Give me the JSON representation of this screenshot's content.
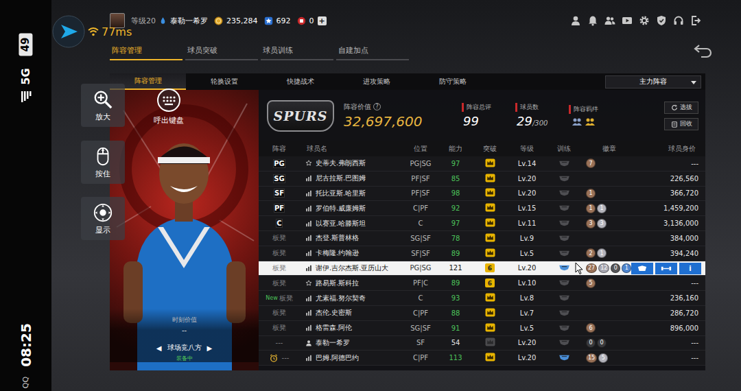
{
  "status_bar": {
    "battery": "49",
    "network": "5G",
    "time": "08:25",
    "app": "QQ"
  },
  "emulator": {
    "ping": "77ms",
    "controls": [
      {
        "label": "放大"
      },
      {
        "label": "呼出键盘"
      },
      {
        "label": "按住"
      },
      {
        "label": "显示"
      }
    ]
  },
  "profile": {
    "level": "等级20",
    "name": "泰勒一希罗",
    "coins": "235,284",
    "stars": "692",
    "tickets": "0",
    "add": "+"
  },
  "tabs": [
    {
      "label": "阵容管理",
      "selected": true
    },
    {
      "label": "球员突破",
      "selected": false
    },
    {
      "label": "球员训练",
      "selected": false
    },
    {
      "label": "自建加点",
      "selected": false
    }
  ],
  "sub_tabs": [
    {
      "label": "阵容管理",
      "selected": true
    },
    {
      "label": "轮换设置",
      "selected": false
    },
    {
      "label": "快捷战术",
      "selected": false
    },
    {
      "label": "进攻策略",
      "selected": false
    },
    {
      "label": "防守策略",
      "selected": false
    }
  ],
  "lineup_select": {
    "value": "主力阵容"
  },
  "player_card": {
    "value_label": "时刻价值",
    "value": "--",
    "prev": "◀",
    "skin": "球场竞八方",
    "next": "▶",
    "status": "装备中"
  },
  "summary": {
    "logo": "SPURS",
    "value_label": "阵容价值",
    "help": "?",
    "value": "32,697,600",
    "stats": [
      {
        "label": "阵容总评",
        "value": "99"
      },
      {
        "label": "球员数",
        "value": "29",
        "suffix": "/300"
      },
      {
        "label": "阵容羁绊"
      }
    ],
    "buttons": [
      "选拔",
      "回收"
    ]
  },
  "table": {
    "columns": [
      "阵容",
      "球员名",
      "位置",
      "能力",
      "突破",
      "等级",
      "训练",
      "徽章",
      "球员身价"
    ],
    "rows": [
      {
        "slot": "PG",
        "starter": true,
        "kind": "star",
        "name": "史蒂夫.弗朗西斯",
        "position": "PG|SG",
        "ability": "97",
        "ability_color": "#4cc35a",
        "breakthrough_on": true,
        "level": "Lv.14",
        "trained": false,
        "badges": [
          {
            "count": "7",
            "color": "#9a7258"
          }
        ],
        "value": "---",
        "selected": false
      },
      {
        "slot": "SG",
        "starter": true,
        "kind": "bars",
        "name": "尼古拉斯.巴图姆",
        "position": "PF|SF",
        "ability": "85",
        "ability_color": "#4cc35a",
        "breakthrough_on": true,
        "level": "Lv.20",
        "trained": false,
        "badges": [],
        "value": "226,560",
        "selected": false
      },
      {
        "slot": "SF",
        "starter": true,
        "kind": "bars",
        "name": "托比亚斯.哈里斯",
        "position": "PF|SF",
        "ability": "98",
        "ability_color": "#4cc35a",
        "breakthrough_on": true,
        "level": "Lv.20",
        "trained": false,
        "badges": [
          {
            "count": "1",
            "color": "#9a7258"
          }
        ],
        "value": "366,720",
        "selected": false
      },
      {
        "slot": "PF",
        "starter": true,
        "kind": "bars",
        "name": "罗伯特.威廉姆斯",
        "position": "C|PF",
        "ability": "92",
        "ability_color": "#4cc35a",
        "breakthrough_on": true,
        "level": "Lv.15",
        "trained": false,
        "badges": [
          {
            "count": "1",
            "color": "#9a7258"
          },
          {
            "count": "1",
            "color": "#b4b4bc"
          }
        ],
        "value": "1,459,200",
        "selected": false
      },
      {
        "slot": "C",
        "starter": true,
        "kind": "bars",
        "name": "以赛亚.哈滕斯坦",
        "position": "C",
        "ability": "97",
        "ability_color": "#4cc35a",
        "breakthrough_on": true,
        "level": "Lv.11",
        "trained": false,
        "badges": [
          {
            "count": "3",
            "color": "#9a7258"
          },
          {
            "count": "3",
            "color": "#b4b4bc"
          }
        ],
        "value": "3,136,000",
        "selected": false
      },
      {
        "slot": "板凳",
        "starter": false,
        "kind": "bars",
        "name": "杰登.斯普林格",
        "position": "SG|SF",
        "ability": "78",
        "ability_color": "#4cc35a",
        "breakthrough_on": true,
        "level": "Lv.9",
        "trained": false,
        "badges": [],
        "value": "384,000",
        "selected": false
      },
      {
        "slot": "板凳",
        "starter": false,
        "kind": "bars",
        "name": "卡梅隆.约翰逊",
        "position": "SF|SF",
        "ability": "89",
        "ability_color": "#4cc35a",
        "breakthrough_on": true,
        "level": "Lv.5",
        "trained": false,
        "badges": [
          {
            "count": "2",
            "color": "#9a7258"
          },
          {
            "count": "1",
            "color": "#b4b4bc"
          }
        ],
        "value": "394,240",
        "selected": false
      },
      {
        "slot": "板凳",
        "starter": false,
        "kind": "bars",
        "name": "谢伊.吉尔杰斯.亚历山大",
        "position": "PG|SG",
        "ability": "121",
        "ability_color": "#111111",
        "breakthrough_on": true,
        "breakthrough": "6",
        "level": "Lv.20",
        "trained": true,
        "badges": [
          {
            "count": "27",
            "color": "#9a7258"
          },
          {
            "count": "12",
            "color": "#a8a8b2"
          },
          {
            "count": "0",
            "color": "#555558"
          },
          {
            "count": "1",
            "color": "#4f86cf"
          }
        ],
        "actions": {
          "info": "i"
        },
        "selected": true
      },
      {
        "slot": "板凳",
        "starter": false,
        "kind": "star",
        "name": "路易斯.斯科拉",
        "position": "PF|C",
        "ability": "89",
        "ability_color": "#4cc35a",
        "breakthrough_on": true,
        "breakthrough": "6",
        "level": "Lv.10",
        "trained": false,
        "badges": [
          {
            "count": "5",
            "color": "#9a7258"
          }
        ],
        "value": "---",
        "selected": false
      },
      {
        "slot": "板凳",
        "tag": "New",
        "starter": false,
        "kind": "bars",
        "name": "尤素福.努尔契奇",
        "position": "C",
        "ability": "93",
        "ability_color": "#4cc35a",
        "breakthrough_on": true,
        "level": "Lv.8",
        "trained": false,
        "badges": [],
        "value": "236,160",
        "selected": false
      },
      {
        "slot": "板凳",
        "starter": false,
        "kind": "bars",
        "name": "杰伦.史密斯",
        "position": "C|PF",
        "ability": "88",
        "ability_color": "#4cc35a",
        "breakthrough_on": true,
        "level": "Lv.7",
        "trained": false,
        "badges": [],
        "value": "286,720",
        "selected": false
      },
      {
        "slot": "板凳",
        "starter": false,
        "kind": "bars",
        "name": "格雷森.阿伦",
        "position": "SG|SF",
        "ability": "91",
        "ability_color": "#4cc35a",
        "breakthrough_on": true,
        "level": "Lv.5",
        "trained": false,
        "badges": [
          {
            "count": "6",
            "color": "#9a7258"
          }
        ],
        "value": "896,000",
        "selected": false
      },
      {
        "slot": "---",
        "starter": false,
        "kind": "person",
        "name": "泰勒一希罗",
        "position": "SF",
        "ability": "54",
        "ability_color": "#e6e6e6",
        "breakthrough_on": false,
        "level": "Lv.20",
        "trained": false,
        "badges": [
          {
            "count": "0",
            "color": "#3a3a3d"
          },
          {
            "count": "0",
            "color": "#3a3a3d"
          }
        ],
        "value": "---",
        "selected": false
      },
      {
        "slot": "---",
        "alarm": true,
        "starter": false,
        "kind": "bars",
        "name": "巴姆.阿德巴约",
        "position": "C|PF",
        "ability": "113",
        "ability_color": "#4cc35a",
        "breakthrough_on": true,
        "level": "Lv.20",
        "trained": true,
        "badges": [
          {
            "count": "15",
            "color": "#9a7258"
          },
          {
            "count": "5",
            "color": "#b4b4bc"
          }
        ],
        "value": "---",
        "selected": false
      }
    ]
  }
}
